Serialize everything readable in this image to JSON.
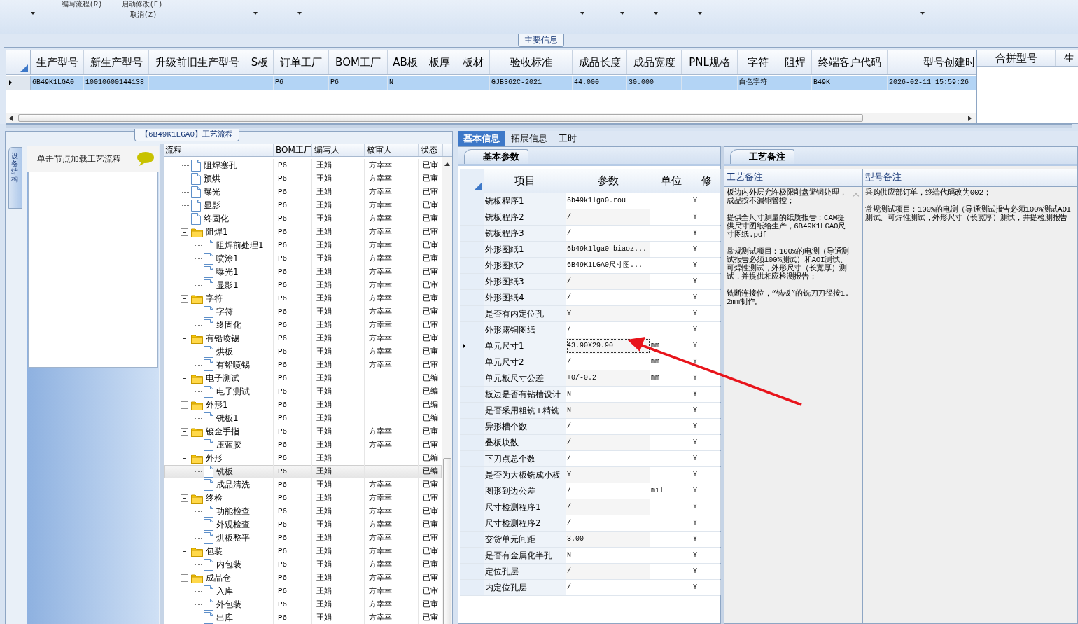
{
  "toolbar": {
    "commands": [
      {
        "label": "编写流程(R)"
      },
      {
        "label": "启动修改(E)"
      },
      {
        "label": "取消(Z)"
      }
    ]
  },
  "main_info": {
    "tab": "主要信息",
    "columns": [
      "生产型号",
      "新生产型号",
      "升级前旧生产型号",
      "S板",
      "订单工厂",
      "BOM工厂",
      "AB板",
      "板厚",
      "板材",
      "验收标准",
      "成品长度",
      "成品宽度",
      "PNL规格",
      "字符",
      "阻焊",
      "终端客户代码",
      "型号创建时"
    ],
    "rows": [
      {
        "selected": true,
        "cells": [
          "6B49K1LGA0",
          "10010600144138",
          null,
          null,
          "P6",
          "P6",
          "N",
          null,
          null,
          "GJB362C-2021",
          "44.000",
          "30.000",
          null,
          "白色字符",
          null,
          "B49K",
          "2026-02-11 15:59:26"
        ]
      }
    ],
    "side_columns": [
      "合拼型号",
      "生"
    ]
  },
  "process_panel": {
    "title": "【6B49K1LGA0】工艺流程",
    "side_tab": "设备结构",
    "hint": "单击节点加载工艺流程",
    "columns": [
      "流程",
      "BOM工厂",
      "编写人",
      "核审人",
      "状态"
    ],
    "tree": [
      {
        "children": [
          {
            "label": "阻焊塞孔",
            "kind": "doc",
            "selected": false,
            "bom": "P6",
            "writer": "王娟",
            "reviewer": "方幸幸",
            "status": "已审"
          },
          {
            "label": "预烘",
            "kind": "doc",
            "selected": false,
            "bom": "P6",
            "writer": "王娟",
            "reviewer": "方幸幸",
            "status": "已审"
          },
          {
            "label": "曝光",
            "kind": "doc",
            "selected": false,
            "bom": "P6",
            "writer": "王娟",
            "reviewer": "方幸幸",
            "status": "已审"
          },
          {
            "label": "显影",
            "kind": "doc",
            "selected": false,
            "bom": "P6",
            "writer": "王娟",
            "reviewer": "方幸幸",
            "status": "已审"
          },
          {
            "label": "终固化",
            "kind": "doc",
            "selected": false,
            "bom": "P6",
            "writer": "王娟",
            "reviewer": "方幸幸",
            "status": "已审"
          }
        ]
      },
      {
        "label": "阻焊1",
        "kind": "folder",
        "expanded": true,
        "selected": false,
        "bom": "P6",
        "writer": "王娟",
        "reviewer": "方幸幸",
        "status": "已审",
        "children": [
          {
            "label": "阻焊前处理1",
            "kind": "doc",
            "selected": false,
            "bom": "P6",
            "writer": "王娟",
            "reviewer": "方幸幸",
            "status": "已审"
          },
          {
            "label": "喷涂1",
            "kind": "doc",
            "selected": false,
            "bom": "P6",
            "writer": "王娟",
            "reviewer": "方幸幸",
            "status": "已审"
          },
          {
            "label": "曝光1",
            "kind": "doc",
            "selected": false,
            "bom": "P6",
            "writer": "王娟",
            "reviewer": "方幸幸",
            "status": "已审"
          },
          {
            "label": "显影1",
            "kind": "doc",
            "selected": false,
            "bom": "P6",
            "writer": "王娟",
            "reviewer": "方幸幸",
            "status": "已审"
          }
        ]
      },
      {
        "label": "字符",
        "kind": "folder",
        "expanded": true,
        "selected": false,
        "bom": "P6",
        "writer": "王娟",
        "reviewer": "方幸幸",
        "status": "已审",
        "children": [
          {
            "label": "字符",
            "kind": "doc",
            "selected": false,
            "bom": "P6",
            "writer": "王娟",
            "reviewer": "方幸幸",
            "status": "已审"
          },
          {
            "label": "终固化",
            "kind": "doc",
            "selected": false,
            "bom": "P6",
            "writer": "王娟",
            "reviewer": "方幸幸",
            "status": "已审"
          }
        ]
      },
      {
        "label": "有铅喷锡",
        "kind": "folder",
        "expanded": true,
        "selected": false,
        "bom": "P6",
        "writer": "王娟",
        "reviewer": "方幸幸",
        "status": "已审",
        "children": [
          {
            "label": "烘板",
            "kind": "doc",
            "selected": false,
            "bom": "P6",
            "writer": "王娟",
            "reviewer": "方幸幸",
            "status": "已审"
          },
          {
            "label": "有铅喷锡",
            "kind": "doc",
            "selected": false,
            "bom": "P6",
            "writer": "王娟",
            "reviewer": "方幸幸",
            "status": "已审"
          }
        ]
      },
      {
        "label": "电子测试",
        "kind": "folder",
        "expanded": true,
        "selected": false,
        "bom": "P6",
        "writer": "王娟",
        "status": "已编",
        "children": [
          {
            "label": "电子测试",
            "kind": "doc",
            "selected": false,
            "bom": "P6",
            "writer": "王娟",
            "status": "已编"
          }
        ]
      },
      {
        "label": "外形1",
        "kind": "folder",
        "expanded": true,
        "selected": false,
        "bom": "P6",
        "writer": "王娟",
        "status": "已编",
        "children": [
          {
            "label": "铣板1",
            "kind": "doc",
            "selected": false,
            "bom": "P6",
            "writer": "王娟",
            "status": "已编"
          }
        ]
      },
      {
        "label": "镀金手指",
        "kind": "folder",
        "expanded": true,
        "selected": false,
        "bom": "P6",
        "writer": "王娟",
        "reviewer": "方幸幸",
        "status": "已审",
        "children": [
          {
            "label": "压蓝胶",
            "kind": "doc",
            "selected": false,
            "bom": "P6",
            "writer": "王娟",
            "reviewer": "方幸幸",
            "status": "已审"
          }
        ]
      },
      {
        "label": "外形",
        "kind": "folder",
        "expanded": true,
        "selected": false,
        "bom": "P6",
        "writer": "王娟",
        "status": "已编",
        "children": [
          {
            "label": "铣板",
            "kind": "doc",
            "selected": true,
            "bom": "P6",
            "writer": "王娟",
            "status": "已编"
          },
          {
            "label": "成品清洗",
            "kind": "doc",
            "selected": false,
            "bom": "P6",
            "writer": "王娟",
            "reviewer": "方幸幸",
            "status": "已审"
          }
        ]
      },
      {
        "label": "终检",
        "kind": "folder",
        "expanded": true,
        "selected": false,
        "bom": "P6",
        "writer": "王娟",
        "reviewer": "方幸幸",
        "status": "已审",
        "children": [
          {
            "label": "功能检查",
            "kind": "doc",
            "selected": false,
            "bom": "P6",
            "writer": "王娟",
            "reviewer": "方幸幸",
            "status": "已审"
          },
          {
            "label": "外观检查",
            "kind": "doc",
            "selected": false,
            "bom": "P6",
            "writer": "王娟",
            "reviewer": "方幸幸",
            "status": "已审"
          },
          {
            "label": "烘板整平",
            "kind": "doc",
            "selected": false,
            "bom": "P6",
            "writer": "王娟",
            "reviewer": "方幸幸",
            "status": "已审"
          }
        ]
      },
      {
        "label": "包装",
        "kind": "folder",
        "expanded": true,
        "selected": false,
        "bom": "P6",
        "writer": "王娟",
        "reviewer": "方幸幸",
        "status": "已审",
        "children": [
          {
            "label": "内包装",
            "kind": "doc",
            "selected": false,
            "bom": "P6",
            "writer": "王娟",
            "reviewer": "方幸幸",
            "status": "已审"
          }
        ]
      },
      {
        "label": "成品仓",
        "kind": "folder",
        "expanded": true,
        "selected": false,
        "bom": "P6",
        "writer": "王娟",
        "reviewer": "方幸幸",
        "status": "已审",
        "children": [
          {
            "label": "入库",
            "kind": "doc",
            "selected": false,
            "bom": "P6",
            "writer": "王娟",
            "reviewer": "方幸幸",
            "status": "已审"
          },
          {
            "label": "外包装",
            "kind": "doc",
            "selected": false,
            "bom": "P6",
            "writer": "王娟",
            "reviewer": "方幸幸",
            "status": "已审"
          },
          {
            "label": "出库",
            "kind": "doc",
            "selected": false,
            "bom": "P6",
            "writer": "王娟",
            "reviewer": "方幸幸",
            "status": "已审"
          }
        ]
      }
    ]
  },
  "detail_tabs": [
    {
      "label": "基本信息",
      "selected": true
    },
    {
      "label": "拓展信息",
      "selected": false
    },
    {
      "label": "工时",
      "selected": false
    }
  ],
  "params": {
    "tab": "基本参数",
    "columns": [
      "项目",
      "参数",
      "单位",
      "修"
    ],
    "rows": [
      {
        "item": "铣板程序1",
        "value": "6b49k1lga0.rou",
        "modify": "Y",
        "selected": false
      },
      {
        "item": "铣板程序2",
        "value": "/",
        "modify": "Y",
        "selected": false
      },
      {
        "item": "铣板程序3",
        "value": "/",
        "modify": "Y",
        "selected": false
      },
      {
        "item": "外形图纸1",
        "value": "6b49k1lga0_biaoz...",
        "modify": "Y",
        "selected": false
      },
      {
        "item": "外形图纸2",
        "value": "6B49K1LGA0尺寸图...",
        "modify": "Y",
        "selected": false
      },
      {
        "item": "外形图纸3",
        "value": "/",
        "modify": "Y",
        "selected": false
      },
      {
        "item": "外形图纸4",
        "value": "/",
        "modify": "Y",
        "selected": false
      },
      {
        "item": "是否有内定位孔",
        "value": "Y",
        "modify": "Y",
        "selected": false
      },
      {
        "item": "外形露铜图纸",
        "value": "/",
        "modify": "Y",
        "selected": false
      },
      {
        "item": "单元尺寸1",
        "value": "43.90X29.90",
        "unit": "mm",
        "modify": "Y",
        "selected": true
      },
      {
        "item": "单元尺寸2",
        "value": "/",
        "unit": "mm",
        "modify": "Y",
        "selected": false
      },
      {
        "item": "单元板尺寸公差",
        "value": "+0/-0.2",
        "unit": "mm",
        "modify": "Y",
        "selected": false
      },
      {
        "item": "板边是否有钻槽设计",
        "value": "N",
        "modify": "Y",
        "selected": false
      },
      {
        "item": "是否采用粗铣+精铣",
        "value": "N",
        "modify": "Y",
        "selected": false
      },
      {
        "item": "异形槽个数",
        "value": "/",
        "modify": "Y",
        "selected": false
      },
      {
        "item": "叠板块数",
        "value": "/",
        "modify": "Y",
        "selected": false
      },
      {
        "item": "下刀点总个数",
        "value": "/",
        "modify": "Y",
        "selected": false
      },
      {
        "item": "是否为大板铣成小板",
        "value": "Y",
        "modify": "Y",
        "selected": false
      },
      {
        "item": "图形到边公差",
        "value": "/",
        "unit": "mil",
        "modify": "Y",
        "selected": false
      },
      {
        "item": "尺寸检测程序1",
        "value": "/",
        "modify": "Y",
        "selected": false
      },
      {
        "item": "尺寸检测程序2",
        "value": "/",
        "modify": "Y",
        "selected": false
      },
      {
        "item": "交货单元间距",
        "value": "3.00",
        "modify": "Y",
        "selected": false
      },
      {
        "item": "是否有金属化半孔",
        "value": "N",
        "modify": "Y",
        "selected": false
      },
      {
        "item": "定位孔层",
        "value": "/",
        "modify": "Y",
        "selected": false
      },
      {
        "item": "内定位孔层",
        "value": "/",
        "modify": "Y",
        "selected": false
      }
    ]
  },
  "notes": {
    "tab": "工艺备注",
    "columns": [
      {
        "title": "工艺备注",
        "paragraphs": [
          "板边内外层允许极限削盘避铜处理，成品按不漏铜管控；",
          "提供全尺寸测量的纸质报告；CAM提供尺寸图纸给生产，6B49K1LGA0尺寸图纸.pdf",
          "常规测试项目：100%的电测（导通测试报告必须100%测试）和AOI测试、可焊性测试，外形尺寸（长宽厚）测试，并提供相应检测报告；",
          "铣断连接位，“铣板”的铣刀刀径按1.2mm制作。"
        ]
      },
      {
        "title": "型号备注",
        "paragraphs": [
          "采购供应部订单，终端代码改为002；",
          "常规测试项目：100%的电测（导通测试报告必须100%测试AOI测试、可焊性测试，外形尺寸（长宽厚）测试，并提检测报告"
        ]
      }
    ]
  }
}
